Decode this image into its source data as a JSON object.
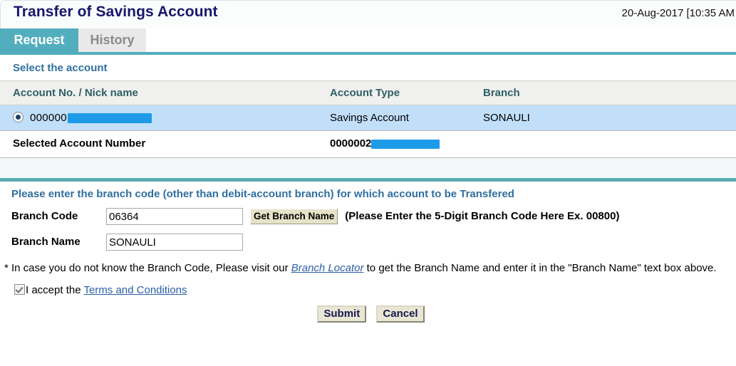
{
  "header": {
    "title": "Transfer of Savings Account",
    "timestamp": "20-Aug-2017 [10:35 AM"
  },
  "tabs": [
    {
      "label": "Request",
      "active": true
    },
    {
      "label": "History",
      "active": false
    }
  ],
  "section": {
    "heading": "Select the account"
  },
  "account_table": {
    "columns": [
      "Account No. / Nick name",
      "Account Type",
      "Branch"
    ],
    "rows": [
      {
        "account_no": "000000",
        "account_no_redacted": true,
        "account_type": "Savings Account",
        "branch": "SONAULI",
        "selected": true
      }
    ],
    "selected_label": "Selected Account Number",
    "selected_value": "0000002",
    "selected_value_redacted": true
  },
  "form": {
    "instruction": "Please enter the branch code (other than debit-account branch) for which account to be Transfered",
    "branch_code_label": "Branch Code",
    "branch_code_value": "06364",
    "get_branch_name_label": "Get Branch Name",
    "branch_code_hint": "(Please Enter the 5-Digit Branch Code Here Ex. 00800)",
    "branch_name_label": "Branch Name",
    "branch_name_value": "SONAULI",
    "note_before": "* In case you do not know the Branch Code, Please visit our ",
    "note_link": "Branch Locator",
    "note_after": " to get the Branch Name and enter it in the \"Branch Name\" text box above.",
    "accept_text": "I accept the ",
    "accept_link": "Terms and Conditions",
    "accept_checked": true,
    "submit_label": "Submit",
    "cancel_label": "Cancel"
  },
  "colors": {
    "title": "#17176b",
    "tab_active_bg": "#52adbd",
    "tab_inactive_bg": "#e9e9e9",
    "section_heading": "#2f6f9f",
    "table_header_bg": "#f0f0ee",
    "selected_row_bg": "#c2dffa",
    "divider_teal": "#5aa9b5",
    "redaction": "#1e9be8",
    "link": "#2b5fa8"
  }
}
